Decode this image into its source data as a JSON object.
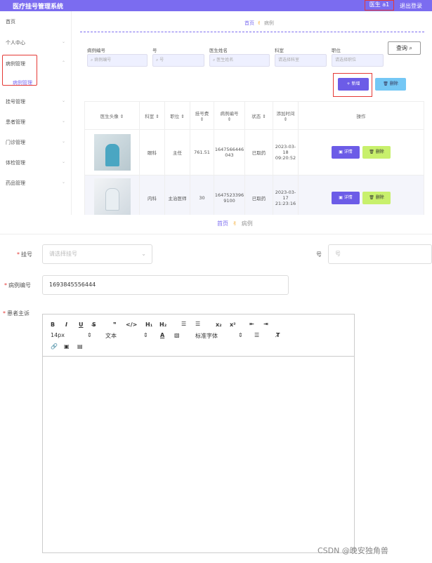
{
  "header": {
    "title": "医疗挂号管理系统",
    "user": "医生 a1",
    "logout": "退出登录"
  },
  "sidebar": {
    "items": [
      {
        "label": "首页"
      },
      {
        "label": "个人中心"
      },
      {
        "label": "病例管理"
      },
      {
        "label": "挂号管理"
      },
      {
        "label": "患者管理"
      },
      {
        "label": "门诊管理"
      },
      {
        "label": "体检管理"
      },
      {
        "label": "药品管理"
      }
    ],
    "sub_item": "病例管理"
  },
  "breadcrumb": {
    "home": "首页",
    "current": "病例"
  },
  "filters": [
    {
      "label": "病例编号",
      "placeholder": "病例编号"
    },
    {
      "label": "号",
      "placeholder": "号"
    },
    {
      "label": "医生姓名",
      "placeholder": "医生姓名"
    },
    {
      "label": "科室",
      "placeholder": "请选择科室"
    },
    {
      "label": "职位",
      "placeholder": "请选择职位"
    }
  ],
  "buttons": {
    "search": "查询",
    "add": "+ 新增",
    "delete": "删除"
  },
  "table": {
    "headers": [
      "医生头像",
      "科室",
      "职位",
      "挂号费",
      "病例编号",
      "状态",
      "添加时间",
      "操作"
    ],
    "rows": [
      {
        "dept": "眼科",
        "position": "主任",
        "fee": "761.51",
        "case_no": "1647566446043",
        "status": "已取药",
        "time": "2023-03-18 09:20:52"
      },
      {
        "dept": "内科",
        "position": "主治医师",
        "fee": "30",
        "case_no": "16475233969100",
        "status": "已取药",
        "time": "2023-03-17 21:23:16"
      }
    ],
    "detail_label": "详情",
    "delete_label": "删除"
  },
  "form": {
    "breadcrumb": {
      "home": "首页",
      "current": "病例"
    },
    "guahao_label": "挂号",
    "guahao_placeholder": "请选择挂号",
    "hao_label": "号",
    "hao_placeholder": "号",
    "case_no_label": "病例编号",
    "case_no_value": "1693845556444",
    "complaint_label": "患者主诉"
  },
  "editor": {
    "font_size": "14px",
    "text_style": "文本",
    "font_family": "标准字体"
  },
  "watermark": "CSDN @晚安独角兽"
}
